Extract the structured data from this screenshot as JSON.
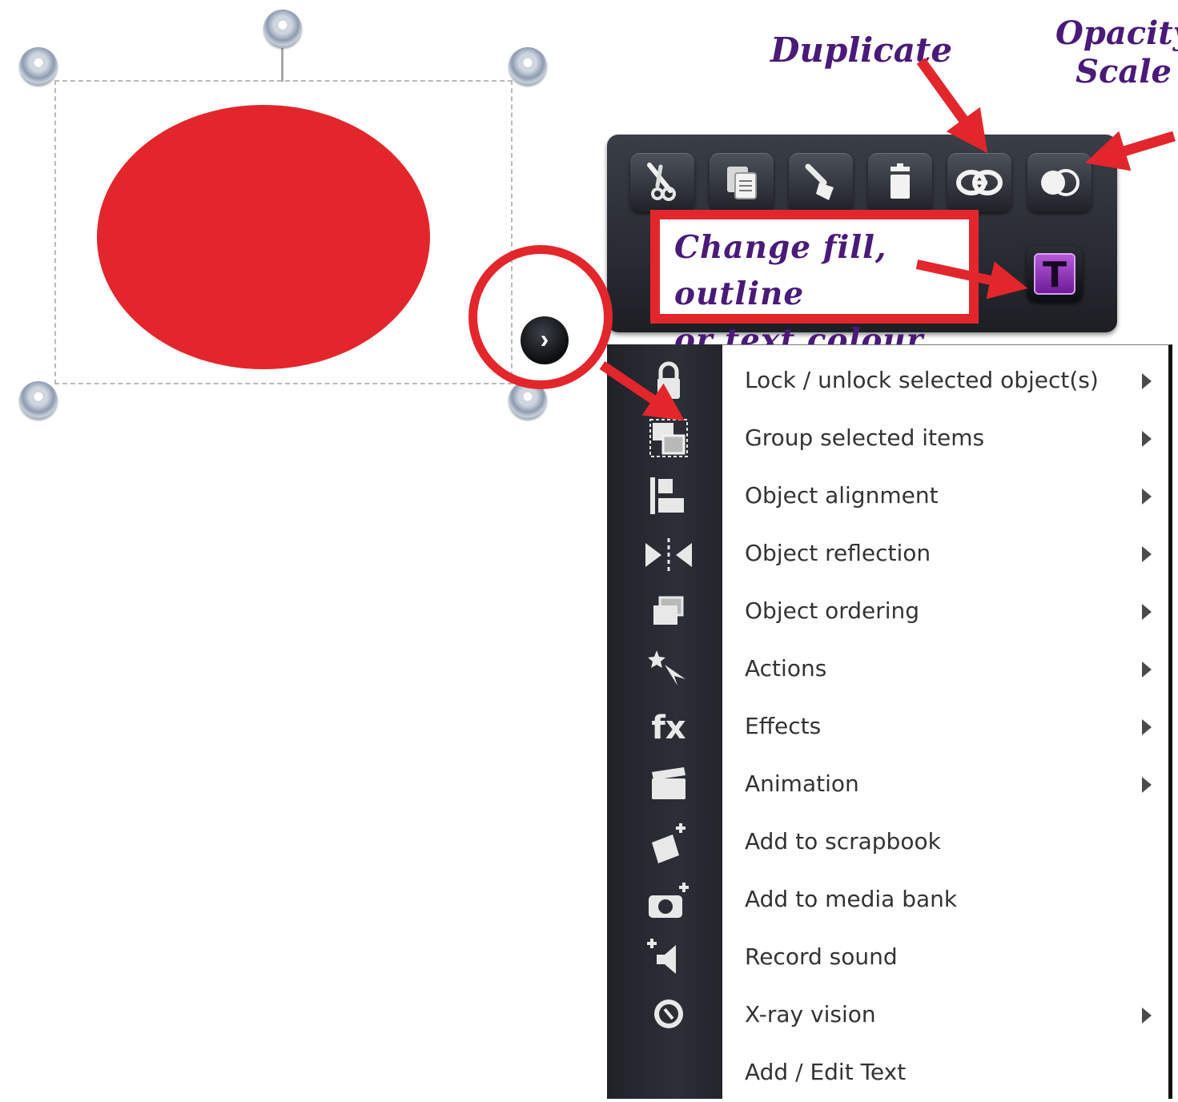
{
  "canvas": {
    "shape_fill": "#e3262c",
    "expand_button_glyph": "›"
  },
  "toolbar": {
    "buttons": [
      {
        "id": "cut",
        "icon": "scissors-icon"
      },
      {
        "id": "copy",
        "icon": "copy-icon"
      },
      {
        "id": "paste",
        "icon": "brush-icon"
      },
      {
        "id": "delete",
        "icon": "trash-icon"
      },
      {
        "id": "duplicate",
        "icon": "duplicate-icon"
      },
      {
        "id": "opacity",
        "icon": "opacity-icon"
      }
    ],
    "text_button_glyph": "T"
  },
  "annotations": {
    "duplicate": "Duplicate",
    "opacity_line1": "Opacity",
    "opacity_line2": "Scale",
    "callout_line1": "Change fill, outline",
    "callout_line2": "or text colour"
  },
  "menu": {
    "items": [
      {
        "label": "Lock / unlock selected object(s)",
        "icon": "lock-icon",
        "submenu": true
      },
      {
        "label": "Group selected items",
        "icon": "group-icon",
        "submenu": true
      },
      {
        "label": "Object alignment",
        "icon": "align-icon",
        "submenu": true
      },
      {
        "label": "Object reflection",
        "icon": "reflect-icon",
        "submenu": true
      },
      {
        "label": "Object ordering",
        "icon": "order-icon",
        "submenu": true
      },
      {
        "label": "Actions",
        "icon": "actions-icon",
        "submenu": true
      },
      {
        "label": "Effects",
        "icon": "fx-icon",
        "submenu": true
      },
      {
        "label": "Animation",
        "icon": "clapper-icon",
        "submenu": true
      },
      {
        "label": "Add to scrapbook",
        "icon": "scrapbook-icon",
        "submenu": false
      },
      {
        "label": "Add to media bank",
        "icon": "camera-icon",
        "submenu": false
      },
      {
        "label": "Record sound",
        "icon": "speaker-icon",
        "submenu": false
      },
      {
        "label": "X-ray vision",
        "icon": "xray-icon",
        "submenu": true
      },
      {
        "label": "Add / Edit Text",
        "icon": "",
        "submenu": false
      }
    ],
    "fx_glyph": "fx"
  },
  "colors": {
    "annotation_red": "#e2262c",
    "annotation_text": "#4a1a78",
    "toolbar_dark": "#25282f"
  }
}
